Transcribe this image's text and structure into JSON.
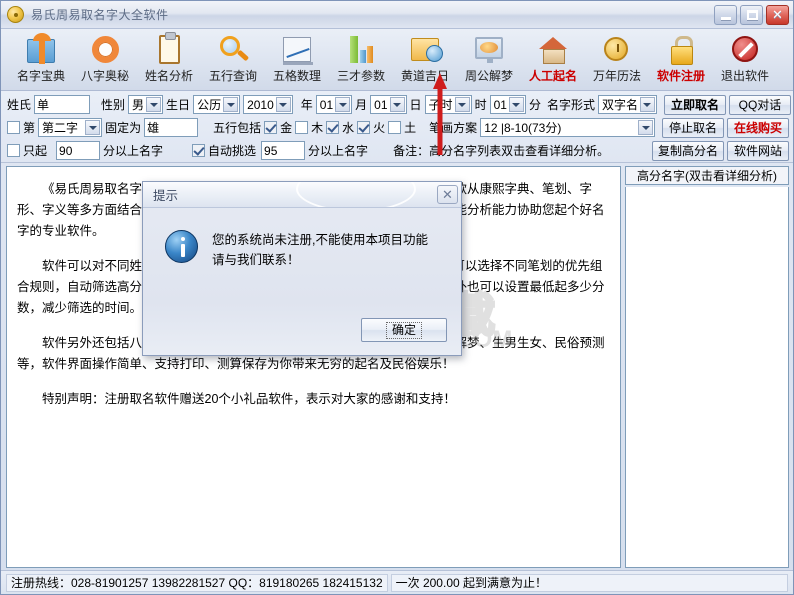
{
  "window": {
    "title": "易氏周易取名字大全软件",
    "icon": "disc-icon",
    "controls": {
      "minimize": "minimize-icon",
      "maximize": "maximize-icon",
      "close": "✕"
    }
  },
  "toolbar": {
    "items": [
      {
        "label": "名字宝典",
        "icon": "gift-icon",
        "red": false
      },
      {
        "label": "八字奥秘",
        "icon": "lifering-icon",
        "red": false
      },
      {
        "label": "姓名分析",
        "icon": "clipboard-icon",
        "red": false
      },
      {
        "label": "五行查询",
        "icon": "magnifier-icon",
        "red": false
      },
      {
        "label": "五格数理",
        "icon": "chart-grid-icon",
        "red": false
      },
      {
        "label": "三才参数",
        "icon": "bar-chart-icon",
        "red": false
      },
      {
        "label": "黄道吉日",
        "icon": "calendar-clock-icon",
        "red": false
      },
      {
        "label": "周公解梦",
        "icon": "monitor-icon",
        "red": false
      },
      {
        "label": "人工起名",
        "icon": "house-icon",
        "red": true
      },
      {
        "label": "万年历法",
        "icon": "clock-icon",
        "red": false
      },
      {
        "label": "软件注册",
        "icon": "lock-icon",
        "red": true
      },
      {
        "label": "退出软件",
        "icon": "forbidden-icon",
        "red": false
      }
    ]
  },
  "form": {
    "row1": {
      "surname_label": "姓氏",
      "surname_value": "单",
      "gender_label": "性别",
      "gender_value": "男",
      "birthday_label": "生日",
      "calendar_value": "公历",
      "year_value": "2010",
      "year_unit": "年",
      "month_value": "01",
      "month_unit": "月",
      "day_value": "01",
      "day_unit": "日",
      "hour_value": "子时",
      "hour_unit": "时",
      "minute_value": "01",
      "minute_unit": "分",
      "nameform_label": "名字形式",
      "nameform_value": "双字名",
      "btn_name_now": "立即取名",
      "btn_qq": "QQ对话"
    },
    "row2": {
      "fix_prefix": "第",
      "fix_position": "第二字",
      "fix_mid": "固定为",
      "fix_char": "雄",
      "wuxing_label": "五行包括",
      "wuxing": [
        {
          "label": "金",
          "checked": true
        },
        {
          "label": "木",
          "checked": false
        },
        {
          "label": "水",
          "checked": true
        },
        {
          "label": "火",
          "checked": true
        },
        {
          "label": "土",
          "checked": false
        }
      ],
      "stroke_label": "笔画方案",
      "stroke_value": "12 |8-10(73分)",
      "btn_stop": "停止取名",
      "btn_buy": "在线购买"
    },
    "row3": {
      "only_label": "只起",
      "only_checked": false,
      "only_value": "90",
      "only_suffix": "分以上名字",
      "auto_label": "自动挑选",
      "auto_checked": true,
      "auto_value": "95",
      "auto_suffix": "分以上名字",
      "note": "备注：高分名字列表双击查看详细分析。",
      "btn_copy": "复制高分名",
      "btn_site": "软件网站"
    }
  },
  "document": {
    "paragraphs": [
      "《易氏周易取名字大全软件》在取名软件行业中是最优秀、最专业的。是一款从康熙字典、笔划、字形、字义等多方面结合传统姓名学和现代姓名研究学，利用高科技电脑的快速智能分析能力协助您起个好名字的专业软件。",
      "软件可以对不同姓field进行组合取名，可以固定名字的第二字或第三个字，可以选择不同笔划的优先组合规则，自动筛选高分名字到高分列表，然后可以查看每个名字的详细分析。另外也可以设置最低起多少分数，减少筛选的时间。",
      "软件另外还包括八字分析，姓名分析，起名方法知识参考、黄道吉日查询、解梦、生男生女、民俗预测等，软件界面操作简单、支持打印、测算保存为你带来无穷的起名及民俗娱乐！",
      "特别声明：注册取名软件赠送20个小礼品软件，表示对大家的感谢和支持！"
    ]
  },
  "right_panel": {
    "header": "高分名字(双击看详细分析)"
  },
  "status": {
    "hotline": "注册热线：028-81901257 13982281527 QQ：819180265 182415132",
    "price": "一次 200.00 起到满意为止！"
  },
  "dialog": {
    "title": "提示",
    "close": "✕",
    "icon": "info-icon",
    "message_line1": "您的系统尚未注册,不能使用本项目功能",
    "message_line2": "请与我们联系！",
    "ok_button": "确定"
  },
  "watermark": {
    "text": "安下载",
    "subtext": "XZ.COM"
  },
  "colors": {
    "accent_red": "#cc0000",
    "title_text": "#5c6b85",
    "panel_bg": "#dfe6f2",
    "field_border": "#7f9db9"
  }
}
